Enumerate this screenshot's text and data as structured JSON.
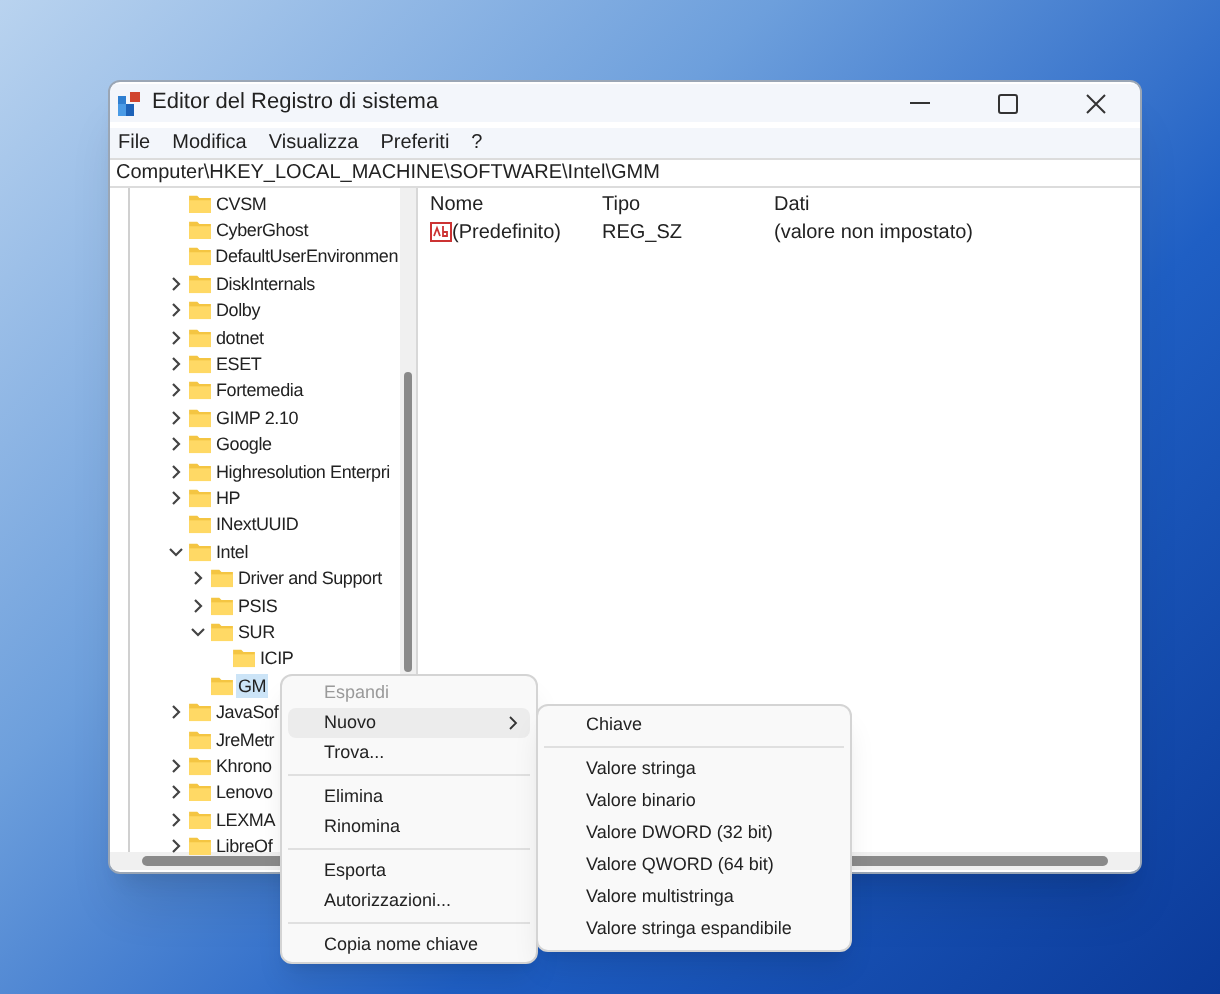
{
  "window": {
    "title": "Editor del Registro di sistema"
  },
  "menu_bar": [
    "File",
    "Modifica",
    "Visualizza",
    "Preferiti",
    "?"
  ],
  "address": "Computer\\HKEY_LOCAL_MACHINE\\SOFTWARE\\Intel\\GMM",
  "tree": [
    {
      "label": "CVSM",
      "kind": "leaf",
      "selected": false
    },
    {
      "label": "CyberGhost",
      "kind": "leaf",
      "selected": false
    },
    {
      "label": "DefaultUserEnvironmen",
      "kind": "leaf",
      "selected": false
    },
    {
      "label": "DiskInternals",
      "kind": "branch",
      "expanded": false,
      "selected": false
    },
    {
      "label": "Dolby",
      "kind": "branch",
      "expanded": false,
      "selected": false
    },
    {
      "label": "dotnet",
      "kind": "branch",
      "expanded": false,
      "selected": false
    },
    {
      "label": "ESET",
      "kind": "branch",
      "expanded": false,
      "selected": false
    },
    {
      "label": "Fortemedia",
      "kind": "branch",
      "expanded": false,
      "selected": false
    },
    {
      "label": "GIMP 2.10",
      "kind": "branch",
      "expanded": false,
      "selected": false
    },
    {
      "label": "Google",
      "kind": "branch",
      "expanded": false,
      "selected": false
    },
    {
      "label": "Highresolution Enterpri",
      "kind": "branch",
      "expanded": false,
      "selected": false
    },
    {
      "label": "HP",
      "kind": "branch",
      "expanded": false,
      "selected": false
    },
    {
      "label": "INextUUID",
      "kind": "leaf",
      "selected": false
    },
    {
      "label": "Intel",
      "kind": "branch",
      "expanded": true,
      "selected": false,
      "children": [
        {
          "label": "Driver and Support",
          "kind": "branch",
          "expanded": false,
          "selected": false
        },
        {
          "label": "PSIS",
          "kind": "branch",
          "expanded": false,
          "selected": false
        },
        {
          "label": "SUR",
          "kind": "branch",
          "expanded": true,
          "selected": false,
          "children": [
            {
              "label": "ICIP",
              "kind": "leaf",
              "selected": false
            }
          ]
        },
        {
          "label": "GM",
          "kind": "leaf",
          "selected": true
        }
      ]
    },
    {
      "label": "JavaSof",
      "kind": "branch",
      "expanded": false,
      "selected": false
    },
    {
      "label": "JreMetr",
      "kind": "leaf",
      "selected": false
    },
    {
      "label": "Khrono",
      "kind": "branch",
      "expanded": false,
      "selected": false
    },
    {
      "label": "Lenovo",
      "kind": "branch",
      "expanded": false,
      "selected": false
    },
    {
      "label": "LEXMA",
      "kind": "branch",
      "expanded": false,
      "selected": false
    },
    {
      "label": "LibreOf",
      "kind": "branch",
      "expanded": false,
      "selected": false
    }
  ],
  "values_table": {
    "columns": [
      "Nome",
      "Tipo",
      "Dati"
    ],
    "rows": [
      {
        "name": "(Predefinito)",
        "type": "REG_SZ",
        "data": "(valore non impostato)"
      }
    ]
  },
  "context_menu": [
    {
      "kind": "item",
      "label": "Espandi",
      "disabled": true,
      "highlighted": false,
      "submenu": false
    },
    {
      "kind": "item",
      "label": "Nuovo",
      "disabled": false,
      "highlighted": true,
      "submenu": true
    },
    {
      "kind": "item",
      "label": "Trova...",
      "disabled": false,
      "highlighted": false,
      "submenu": false
    },
    {
      "kind": "separator"
    },
    {
      "kind": "item",
      "label": "Elimina",
      "disabled": false,
      "highlighted": false,
      "submenu": false
    },
    {
      "kind": "item",
      "label": "Rinomina",
      "disabled": false,
      "highlighted": false,
      "submenu": false
    },
    {
      "kind": "separator"
    },
    {
      "kind": "item",
      "label": "Esporta",
      "disabled": false,
      "highlighted": false,
      "submenu": false
    },
    {
      "kind": "item",
      "label": "Autorizzazioni...",
      "disabled": false,
      "highlighted": false,
      "submenu": false
    },
    {
      "kind": "separator"
    },
    {
      "kind": "item",
      "label": "Copia nome chiave",
      "disabled": false,
      "highlighted": false,
      "submenu": false
    }
  ],
  "submenu": [
    {
      "kind": "item",
      "label": "Chiave"
    },
    {
      "kind": "separator"
    },
    {
      "kind": "item",
      "label": "Valore stringa"
    },
    {
      "kind": "item",
      "label": "Valore binario"
    },
    {
      "kind": "item",
      "label": "Valore DWORD (32 bit)"
    },
    {
      "kind": "item",
      "label": "Valore QWORD (64 bit)"
    },
    {
      "kind": "item",
      "label": "Valore multistringa"
    },
    {
      "kind": "item",
      "label": "Valore stringa espandibile"
    }
  ]
}
